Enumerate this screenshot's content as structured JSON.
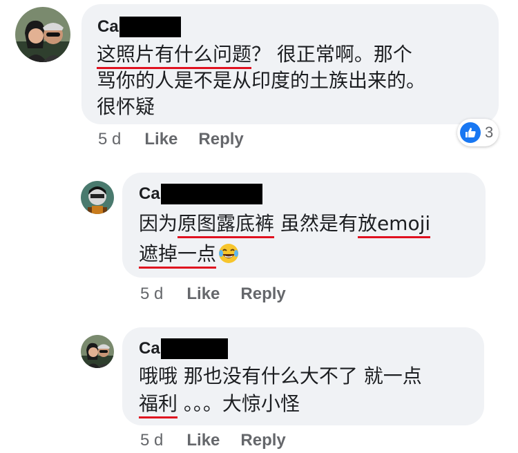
{
  "comments": [
    {
      "author_visible": "Ca",
      "text_line1_prefix": "",
      "text_line1_ul": "这照片有什么问题",
      "text_line1_rest": "？ 很正常啊。那个",
      "text_line2": "骂你的人是不是从印度的土族出来的。",
      "text_line3": "很怀疑",
      "time": "5 d",
      "like_label": "Like",
      "reply_label": "Reply",
      "reaction_count": "3"
    },
    {
      "author_visible": "Ca",
      "text_line1_a": "因为",
      "text_line1_ul1": "原图露底裤",
      "text_line1_b": " 虽然是有",
      "text_line1_ul2": "放emoji",
      "text_line2_ul": "遮掉一点",
      "time": "5 d",
      "like_label": "Like",
      "reply_label": "Reply"
    },
    {
      "author_visible": "Ca",
      "text_line1": "哦哦 那也没有什么大不了 就一点",
      "text_line2_ul": "福利",
      "text_line2_rest": " 。。。大惊小怪",
      "time": "5 d",
      "like_label": "Like",
      "reply_label": "Reply"
    }
  ],
  "icons": {
    "reaction": "like-thumb-icon",
    "emoji": "laughing-tears-emoji-icon"
  },
  "colors": {
    "bubble": "#f0f2f5",
    "underline": "#e0101f",
    "like_blue": "#1877f2",
    "meta_gray": "#65676b"
  }
}
